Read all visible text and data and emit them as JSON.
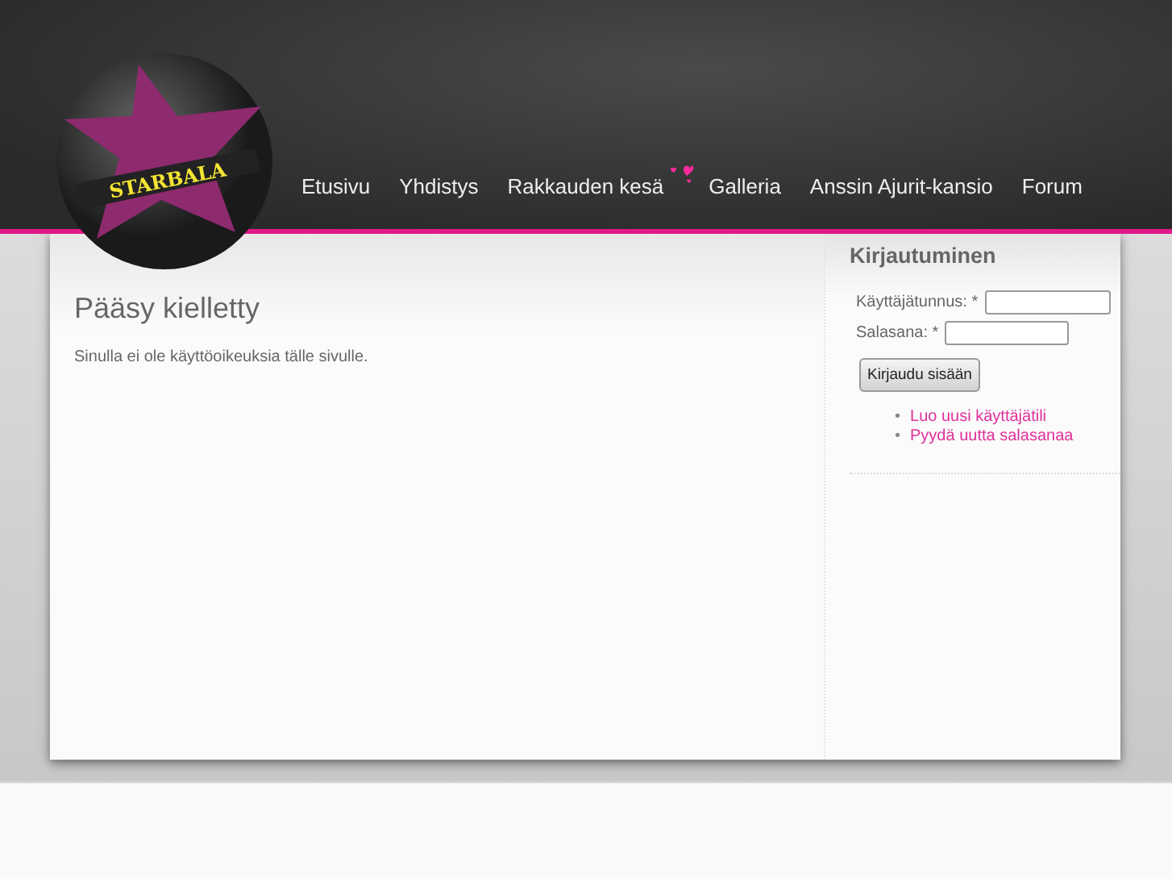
{
  "logo": {
    "text": "STARBALA"
  },
  "nav": [
    {
      "label": "Etusivu",
      "hearts": false
    },
    {
      "label": "Yhdistys",
      "hearts": false
    },
    {
      "label": "Rakkauden kesä",
      "hearts": true
    },
    {
      "label": "Galleria",
      "hearts": false
    },
    {
      "label": "Anssin Ajurit-kansio",
      "hearts": false
    },
    {
      "label": "Forum",
      "hearts": false
    }
  ],
  "main": {
    "title": "Pääsy kielletty",
    "message": "Sinulla ei ole käyttöoikeuksia tälle sivulle."
  },
  "login": {
    "title": "Kirjautuminen",
    "fields": [
      {
        "label": "Käyttäjätunnus:",
        "required_mark": "*"
      },
      {
        "label": "Salasana:",
        "required_mark": "*"
      }
    ],
    "button": "Kirjaudu sisään",
    "links": [
      {
        "bullet": "•",
        "label": "Luo uusi käyttäjätili"
      },
      {
        "bullet": "•",
        "label": "Pyydä uutta salasanaa"
      }
    ]
  }
}
